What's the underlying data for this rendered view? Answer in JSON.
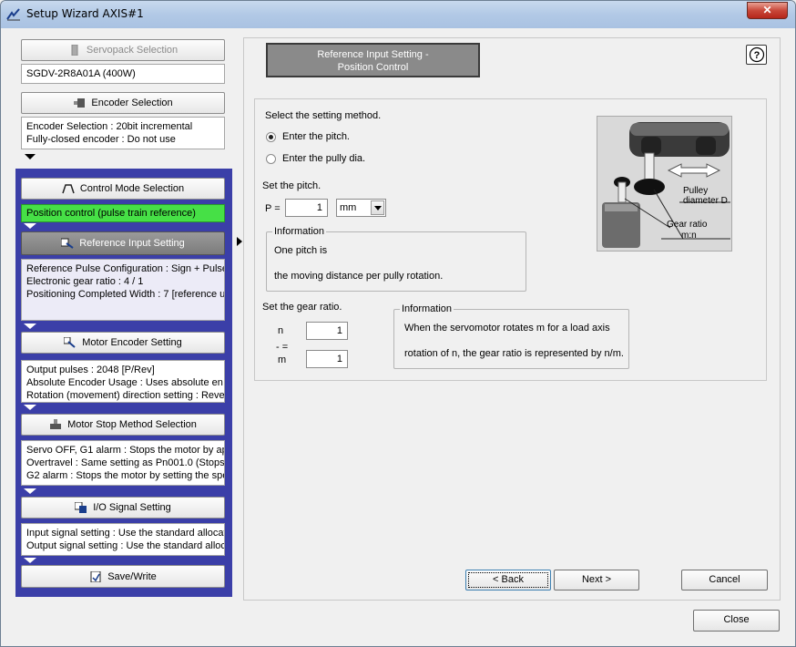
{
  "window": {
    "title": "Setup Wizard AXIS#1",
    "close_glyph": "✕"
  },
  "sidebar": {
    "servopack": {
      "label": "Servopack Selection",
      "value": "SGDV-2R8A01A (400W)"
    },
    "encoder": {
      "label": "Encoder Selection",
      "lines": [
        "Encoder Selection : 20bit incremental",
        "Fully-closed encoder : Do not use"
      ]
    },
    "control_mode": {
      "label": "Control Mode Selection",
      "value": "Position control (pulse train reference)"
    },
    "reference_input": {
      "label": "Reference Input Setting",
      "lines": [
        "Reference Pulse Configuration : Sign + Pulse",
        "Electronic gear ratio : 4 / 1",
        "Positioning Completed Width : 7 [reference u"
      ]
    },
    "motor_encoder": {
      "label": "Motor Encoder Setting",
      "lines": [
        "Output pulses : 2048 [P/Rev]",
        "Absolute Encoder Usage : Uses absolute en",
        "Rotation (movement) direction setting : Reve"
      ]
    },
    "motor_stop": {
      "label": "Motor Stop Method Selection",
      "lines": [
        "Servo OFF, G1 alarm : Stops the motor by ap",
        "Overtravel : Same setting as Pn001.0 (Stops",
        "G2 alarm : Stops the motor by setting the spe"
      ]
    },
    "io_signal": {
      "label": "I/O Signal Setting",
      "lines": [
        "Input signal setting : Use the standard allocat",
        "Output signal setting : Use the standard alloc"
      ]
    },
    "save_write": {
      "label": "Save/Write"
    }
  },
  "page": {
    "header": [
      "Reference Input Setting -",
      "Position Control"
    ],
    "help_glyph": "?",
    "method_prompt": "Select the setting method.",
    "option_pitch": "Enter the pitch.",
    "option_pully": "Enter the pully dia.",
    "pitch_prompt": "Set the pitch.",
    "pitch_label": "P =",
    "pitch_value": "1",
    "pitch_unit": "mm",
    "info1": {
      "legend": "Information",
      "line1": "One pitch is",
      "line2": "the moving distance per pully rotation."
    },
    "gear_prompt": "Set the gear ratio.",
    "gear_n_label": "n",
    "gear_sep": "- =",
    "gear_m_label": "m",
    "gear_n_value": "1",
    "gear_m_value": "1",
    "info2": {
      "legend": "Information",
      "line1": "When the servomotor rotates m for a load axis",
      "line2": "rotation of n, the gear ratio is represented by n/m."
    },
    "diagram": {
      "label_pulley": [
        "Pulley",
        "diameter D"
      ],
      "label_gear": [
        "Gear ratio",
        "m:n"
      ]
    }
  },
  "buttons": {
    "back": "< Back",
    "next": "Next >",
    "cancel": "Cancel",
    "close": "Close"
  }
}
